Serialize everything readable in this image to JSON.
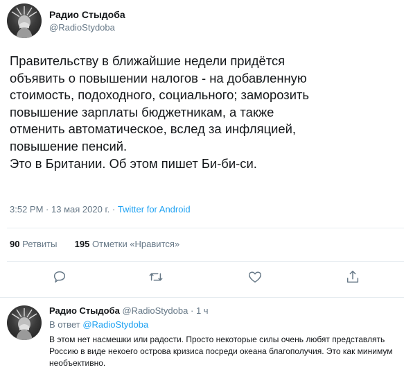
{
  "tweet": {
    "author_name": "Радио Стыдоба",
    "author_handle": "@RadioStydoba",
    "text": "Правительству в ближайшие недели придётся\nобъявить о повышении налогов - на добавленную\nстоимость, подоходного, социального; заморозить\nповышение зарплаты бюджетникам, а также\nотменить автоматическое, вслед за инфляцией,\nповышение пенсий.\nЭто в Британии. Об этом пишет Би-би-си.",
    "time": "3:52 PM",
    "date": "13 мая 2020 г.",
    "separator": "·",
    "source": "Twitter for Android",
    "retweets_count": "90",
    "retweets_label": "Ретвиты",
    "likes_count": "195",
    "likes_label": "Отметки «Нравится»"
  },
  "reply": {
    "author_name": "Радио Стыдоба",
    "author_handle": "@RadioStydoba",
    "separator": "·",
    "age": "1 ч",
    "in_reply_prefix": "В ответ",
    "in_reply_to": "@RadioStydoba",
    "text": "В этом нет насмешки или радости. Просто некоторые силы очень любят представлять Россию в виде некоего острова кризиса посреди океана благополучия. Это как минимум необъективно."
  },
  "icons": {
    "reply": "reply-icon",
    "retweet": "retweet-icon",
    "like": "heart-icon",
    "share": "share-icon",
    "more": "chevron-down-icon"
  },
  "colors": {
    "text": "#14171a",
    "secondary": "#657786",
    "link": "#1da1f2",
    "divider": "#e6ecf0"
  }
}
